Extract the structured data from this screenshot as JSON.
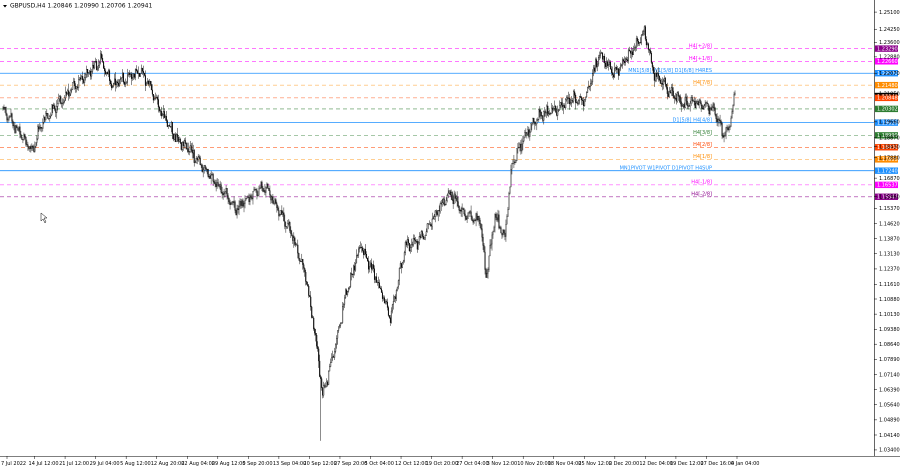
{
  "header": {
    "symbol_line": "GBPUSD,H4  1.20846 1.20990 1.20706 1.20941"
  },
  "colors": {
    "background": "#ffffff",
    "candle": "#000000",
    "blue_level": "#1e90ff",
    "magenta": "#ff00ff",
    "orange": "#ff8c00",
    "red": "#ff4500",
    "darkred": "#8b0000",
    "green": "#2e7d32",
    "purple": "#8b008b"
  },
  "chart_data": {
    "type": "candlestick",
    "symbol": "GBPUSD",
    "timeframe": "H4",
    "ohlc_last": {
      "open": 1.20846,
      "high": 1.2099,
      "low": 1.20706,
      "close": 1.20941
    },
    "ylim": [
      1.03,
      1.256
    ],
    "y_ticks": [
      "1.25100",
      "1.24250",
      "1.23600",
      "1.22880",
      "1.22070",
      "1.21050",
      "1.19660",
      "1.18870",
      "1.18430",
      "1.17880",
      "1.16870",
      "1.15960",
      "1.15370",
      "1.14620",
      "1.13870",
      "1.13130",
      "1.12370",
      "1.11610",
      "1.10880",
      "1.10130",
      "1.09380",
      "1.08640",
      "1.07890",
      "1.07140",
      "1.06390",
      "1.05640",
      "1.04890",
      "1.04140",
      "1.03400"
    ],
    "x_labels": [
      "7 Jul 2022",
      "14 Jul 12:00",
      "21 Jul 12:00",
      "29 Jul 04:00",
      "5 Aug 12:00",
      "12 Aug 20:00",
      "22 Aug 04:00",
      "29 Aug 12:00",
      "5 Sep 20:00",
      "13 Sep 04:00",
      "20 Sep 12:00",
      "27 Sep 20:00",
      "5 Oct 04:00",
      "12 Oct 12:00",
      "19 Oct 20:00",
      "27 Oct 04:00",
      "3 Nov 12:00",
      "10 Nov 20:00",
      "18 Nov 04:00",
      "25 Nov 12:00",
      "2 Dec 20:00",
      "12 Dec 04:00",
      "19 Dec 12:00",
      "27 Dec 16:00",
      "4 Jan 04:00"
    ],
    "anchors": [
      {
        "i": 0,
        "p": 1.203
      },
      {
        "i": 15,
        "p": 1.193
      },
      {
        "i": 30,
        "p": 1.182
      },
      {
        "i": 40,
        "p": 1.196
      },
      {
        "i": 55,
        "p": 1.205
      },
      {
        "i": 70,
        "p": 1.213
      },
      {
        "i": 85,
        "p": 1.22
      },
      {
        "i": 100,
        "p": 1.227
      },
      {
        "i": 110,
        "p": 1.215
      },
      {
        "i": 125,
        "p": 1.218
      },
      {
        "i": 140,
        "p": 1.222
      },
      {
        "i": 150,
        "p": 1.212
      },
      {
        "i": 160,
        "p": 1.202
      },
      {
        "i": 175,
        "p": 1.188
      },
      {
        "i": 190,
        "p": 1.182
      },
      {
        "i": 205,
        "p": 1.172
      },
      {
        "i": 220,
        "p": 1.163
      },
      {
        "i": 235,
        "p": 1.153
      },
      {
        "i": 250,
        "p": 1.16
      },
      {
        "i": 265,
        "p": 1.165
      },
      {
        "i": 275,
        "p": 1.155
      },
      {
        "i": 290,
        "p": 1.142
      },
      {
        "i": 305,
        "p": 1.12
      },
      {
        "i": 315,
        "p": 1.09
      },
      {
        "i": 322,
        "p": 1.06
      },
      {
        "i": 332,
        "p": 1.08
      },
      {
        "i": 345,
        "p": 1.11
      },
      {
        "i": 360,
        "p": 1.136
      },
      {
        "i": 375,
        "p": 1.12
      },
      {
        "i": 390,
        "p": 1.1
      },
      {
        "i": 405,
        "p": 1.135
      },
      {
        "i": 420,
        "p": 1.138
      },
      {
        "i": 435,
        "p": 1.15
      },
      {
        "i": 450,
        "p": 1.162
      },
      {
        "i": 465,
        "p": 1.15
      },
      {
        "i": 480,
        "p": 1.148
      },
      {
        "i": 486,
        "p": 1.12
      },
      {
        "i": 495,
        "p": 1.15
      },
      {
        "i": 505,
        "p": 1.14
      },
      {
        "i": 512,
        "p": 1.175
      },
      {
        "i": 525,
        "p": 1.19
      },
      {
        "i": 540,
        "p": 1.2
      },
      {
        "i": 555,
        "p": 1.202
      },
      {
        "i": 570,
        "p": 1.208
      },
      {
        "i": 585,
        "p": 1.207
      },
      {
        "i": 600,
        "p": 1.23
      },
      {
        "i": 615,
        "p": 1.22
      },
      {
        "i": 630,
        "p": 1.23
      },
      {
        "i": 645,
        "p": 1.241
      },
      {
        "i": 655,
        "p": 1.22
      },
      {
        "i": 670,
        "p": 1.212
      },
      {
        "i": 685,
        "p": 1.205
      },
      {
        "i": 700,
        "p": 1.206
      },
      {
        "i": 715,
        "p": 1.203
      },
      {
        "i": 725,
        "p": 1.19
      },
      {
        "i": 730,
        "p": 1.194
      },
      {
        "i": 736,
        "p": 1.2094
      }
    ],
    "levels": [
      {
        "label": "H4[+2/8]",
        "tag": "1.23290",
        "price": 1.2329,
        "color": "#ff00ff",
        "style": "dash",
        "label_x": 712
      },
      {
        "label": "H4[+1/8]",
        "tag": "1.22660",
        "price": 1.2266,
        "color": "#ff00ff",
        "style": "dash",
        "label_x": 712
      },
      {
        "label": "MN1[5/8] W1[5/8] D1[6/8] H4RES",
        "tag": "1.22070",
        "price": 1.2207,
        "color": "#1e90ff",
        "style": "solid",
        "label_x": 712
      },
      {
        "label": "H4[7/8]",
        "tag": "1.21480",
        "price": 1.2148,
        "color": "#ff8c00",
        "style": "dash",
        "label_x": 712
      },
      {
        "label": "",
        "tag": "1.20941",
        "price": 1.20941,
        "color": "#000000",
        "style": "none",
        "label_x": 0
      },
      {
        "label": "",
        "tag": "1.20848",
        "price": 1.20848,
        "color": "#ff4500",
        "style": "dash",
        "label_x": 0
      },
      {
        "label": "",
        "tag": "1.20302",
        "price": 1.20302,
        "color": "#2e7d32",
        "style": "dash",
        "label_x": 0
      },
      {
        "label": "D1[5/8] H4[4/8]",
        "tag": "1.19620",
        "price": 1.1962,
        "color": "#1e90ff",
        "style": "solid",
        "label_x": 712
      },
      {
        "label": "H4[3/8]",
        "tag": "1.18990",
        "price": 1.1899,
        "color": "#2e7d32",
        "style": "dash",
        "label_x": 712
      },
      {
        "label": "H4[2/8]",
        "tag": "1.18400",
        "price": 1.184,
        "color": "#ff4500",
        "style": "dash",
        "label_x": 712
      },
      {
        "label": "H4[1/8]",
        "tag": "1.17800",
        "price": 1.178,
        "color": "#ff8c00",
        "style": "dash",
        "label_x": 712
      },
      {
        "label": "MN1PIVOT W1PIVOT D1PIVOT H4SUP",
        "tag": "1.17240",
        "price": 1.1724,
        "color": "#1e90ff",
        "style": "solid",
        "label_x": 712
      },
      {
        "label": "H4[-1/8]",
        "tag": "1.16537",
        "price": 1.16537,
        "color": "#ff00ff",
        "style": "dash",
        "label_x": 712
      },
      {
        "label": "H4[-2/8]",
        "tag": "1.15947",
        "price": 1.15947,
        "color": "#8b008b",
        "style": "dash",
        "label_x": 712
      }
    ]
  }
}
